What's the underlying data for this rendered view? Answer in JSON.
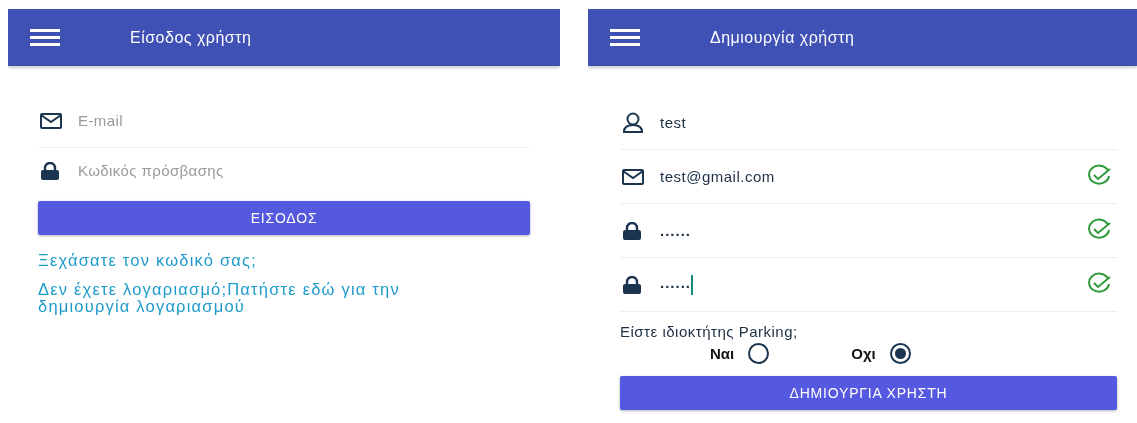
{
  "screens": [
    {
      "kind": "login",
      "title": "Είσοδος χρήστη",
      "fields": [
        {
          "kind": "email",
          "placeholder": "E-mail"
        },
        {
          "kind": "password",
          "placeholder": "Κωδικός πρόσβασης"
        }
      ],
      "button": "ΕΙΣΟΔΟΣ",
      "links": [
        "Ξεχάσατε τον κωδικό σας;",
        "Δεν έχετε λογαριασμό;Πατήστε εδώ για την δημιουργία λογαριασμού"
      ]
    },
    {
      "kind": "signup",
      "title": "Δημιουργία χρήστη",
      "fields": [
        {
          "kind": "user",
          "value": "test",
          "valid": false,
          "focused": false
        },
        {
          "kind": "email",
          "value": "test@gmail.com",
          "valid": true,
          "focused": false
        },
        {
          "kind": "password",
          "value": "......",
          "valid": true,
          "focused": false
        },
        {
          "kind": "password",
          "value": "......",
          "valid": true,
          "focused": true
        }
      ],
      "question": "Είστε ιδιοκτήτης Parking;",
      "options": [
        {
          "label": "Ναι",
          "selected": false
        },
        {
          "label": "Οχι",
          "selected": true
        }
      ],
      "button": "ΔΗΜΙΟΥΡΓΙΑ ΧΡΗΣΤΗ"
    }
  ]
}
